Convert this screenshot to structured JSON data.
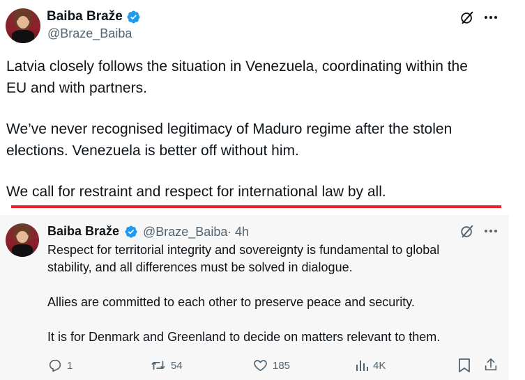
{
  "main_tweet": {
    "author_name": "Baiba Braže",
    "author_handle": "@Braze_Baiba",
    "paragraphs": [
      [
        "Latvia closely follows the situation in Venezuela, coordinating within the",
        "EU and with partners."
      ],
      [
        "We’ve never recognised legitimacy of Maduro regime after the stolen",
        "elections. Venezuela is better off without him."
      ],
      [
        "We call for restraint and respect for international law by all."
      ]
    ]
  },
  "quoted_tweet": {
    "author_name": "Baiba Braže",
    "author_handle": "@Braze_Baiba",
    "time": "· 4h",
    "paragraphs": [
      [
        "Respect for territorial integrity and sovereignty is fundamental to global",
        "stability, and all differences must be solved in dialogue."
      ],
      [
        "Allies are committed to each other to preserve peace and security."
      ],
      [
        "It is for Denmark and Greenland to decide on matters relevant to them."
      ]
    ],
    "stats": {
      "replies": "1",
      "reposts": "54",
      "likes": "185",
      "views": "4K"
    }
  },
  "icons": [
    "verified-badge-icon",
    "grok-icon",
    "more-icon",
    "reply-icon",
    "repost-icon",
    "like-icon",
    "views-icon",
    "bookmark-icon",
    "share-icon"
  ],
  "colors": {
    "verified": "#1d9bf0",
    "highlight_line": "#e8232e",
    "muted": "#536471"
  }
}
